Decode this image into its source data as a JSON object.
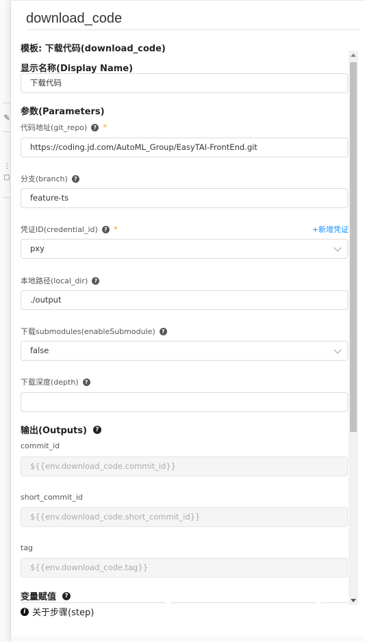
{
  "drawer": {
    "title": "download_code",
    "template_label": "模板: 下载代码(download_code)"
  },
  "display_name": {
    "section": "显示名称(Display Name)",
    "value": "下载代码"
  },
  "parameters": {
    "section": "参数(Parameters)",
    "git_repo": {
      "label": "代码地址(git_repo)",
      "value": "https://coding.jd.com/AutoML_Group/EasyTAI-FrontEnd.git",
      "required": "*"
    },
    "branch": {
      "label": "分支(branch)",
      "value": "feature-ts"
    },
    "credential": {
      "label": "凭证ID(credential_id)",
      "value": "pxy",
      "required": "*",
      "add_link": "+新增凭证"
    },
    "local_dir": {
      "label": "本地路径(local_dir)",
      "value": "./output"
    },
    "submodule": {
      "label": "下载submodules(enableSubmodule)",
      "value": "false"
    },
    "depth": {
      "label": "下载深度(depth)",
      "value": ""
    }
  },
  "outputs": {
    "section": "输出(Outputs)",
    "commit_id": {
      "label": "commit_id",
      "value": "${{env.download_code.commit_id}}"
    },
    "short_commit_id": {
      "label": "short_commit_id",
      "value": "${{env.download_code.short_commit_id}}"
    },
    "tag": {
      "label": "tag",
      "value": "${{env.download_code.tag}}"
    }
  },
  "variables": {
    "section": "变量赋值"
  },
  "footer": {
    "about_step": "关于步骤(step)"
  },
  "icons": {
    "help": "?",
    "info": "i"
  }
}
